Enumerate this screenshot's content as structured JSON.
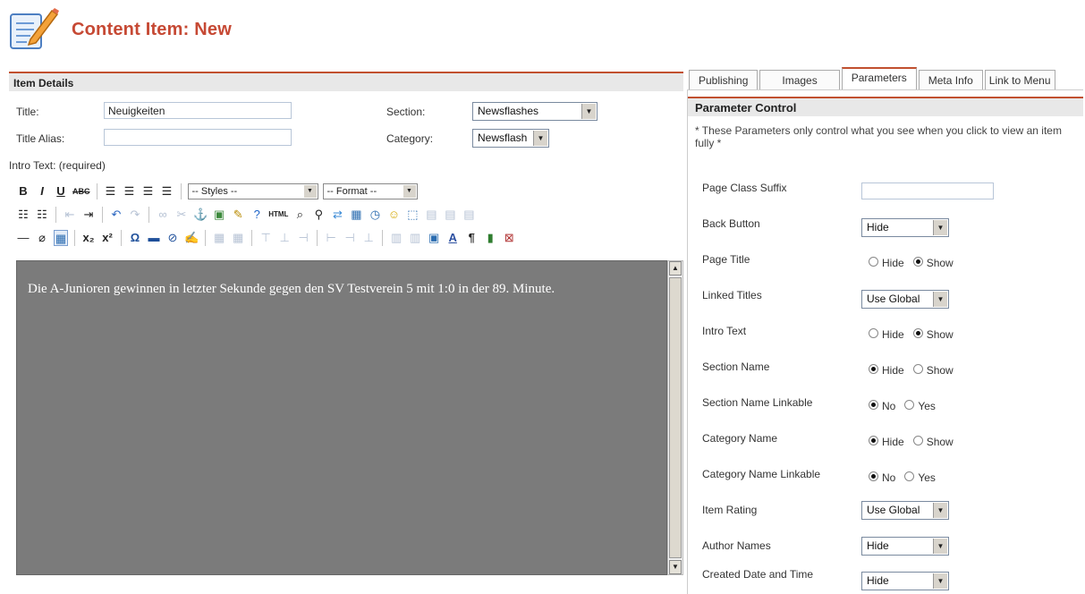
{
  "header": {
    "title_prefix": "Content Item:",
    "title_suffix": "New"
  },
  "details": {
    "heading": "Item Details",
    "title_label": "Title:",
    "title_value": "Neuigkeiten",
    "alias_label": "Title Alias:",
    "alias_value": "",
    "section_label": "Section:",
    "section_value": "Newsflashes",
    "category_label": "Category:",
    "category_value": "Newsflash",
    "intro_label": "Intro Text: (required)"
  },
  "toolbar": {
    "styles_label": "-- Styles --",
    "format_label": "-- Format --"
  },
  "editor": {
    "content": "Die A-Junioren gewinnen in letzter Sekunde gegen den SV Testverein 5 mit 1:0 in der 89. Minute."
  },
  "tabs": [
    "Publishing",
    "Images",
    "Parameters",
    "Meta Info",
    "Link to Menu"
  ],
  "params": {
    "heading": "Parameter Control",
    "note": "* These Parameters only control what you see when you click to view an item fully *",
    "page_class_suffix": {
      "label": "Page Class Suffix",
      "value": ""
    },
    "back_button": {
      "label": "Back Button",
      "value": "Hide"
    },
    "page_title": {
      "label": "Page Title",
      "opt1": "Hide",
      "opt2": "Show",
      "selected": "Show"
    },
    "linked_titles": {
      "label": "Linked Titles",
      "value": "Use Global"
    },
    "intro_text": {
      "label": "Intro Text",
      "opt1": "Hide",
      "opt2": "Show",
      "selected": "Show"
    },
    "section_name": {
      "label": "Section Name",
      "opt1": "Hide",
      "opt2": "Show",
      "selected": "Hide"
    },
    "section_name_linkable": {
      "label": "Section Name Linkable",
      "opt1": "No",
      "opt2": "Yes",
      "selected": "No"
    },
    "category_name": {
      "label": "Category Name",
      "opt1": "Hide",
      "opt2": "Show",
      "selected": "Hide"
    },
    "category_name_linkable": {
      "label": "Category Name Linkable",
      "opt1": "No",
      "opt2": "Yes",
      "selected": "No"
    },
    "item_rating": {
      "label": "Item Rating",
      "value": "Use Global"
    },
    "author_names": {
      "label": "Author Names",
      "value": "Hide"
    },
    "created_date": {
      "label": "Created Date and Time",
      "value": "Hide"
    }
  }
}
